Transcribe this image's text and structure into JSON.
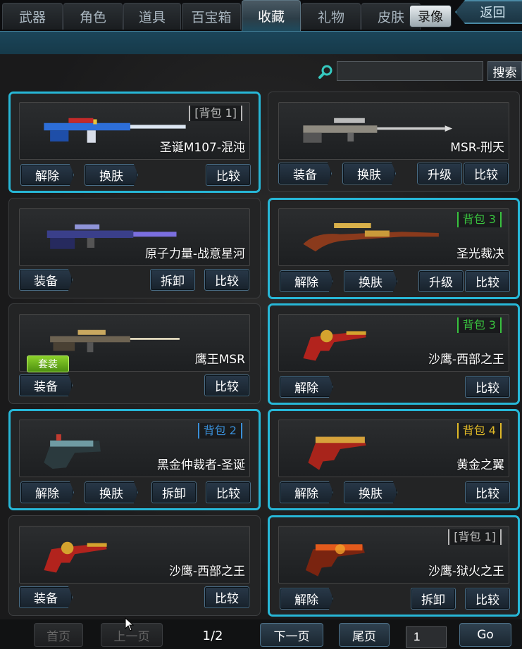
{
  "tabs": [
    {
      "label": "武器",
      "active": false
    },
    {
      "label": "角色",
      "active": false
    },
    {
      "label": "道具",
      "active": false
    },
    {
      "label": "百宝箱",
      "active": false
    },
    {
      "label": "收藏",
      "active": true
    },
    {
      "label": "礼物",
      "active": false
    },
    {
      "label": "皮肤",
      "active": false
    }
  ],
  "header": {
    "video_label": "录像",
    "back_label": "返回"
  },
  "search": {
    "placeholder": "",
    "button_label": "搜索"
  },
  "items": [
    {
      "name": "圣诞M107-混沌",
      "badge": "[背包 1]",
      "badge_color": "#b7b7b7",
      "selected": true,
      "tag": "",
      "buttons": [
        "解除",
        "换肤",
        "比较"
      ],
      "icon": "sniper-rifle-christmas-icon"
    },
    {
      "name": "MSR-刑天",
      "badge": "",
      "badge_color": "",
      "selected": false,
      "tag": "",
      "buttons": [
        "装备",
        "换肤",
        "升级",
        "比较"
      ],
      "icon": "sniper-rifle-silver-icon"
    },
    {
      "name": "原子力量-战意星河",
      "badge": "",
      "badge_color": "",
      "selected": false,
      "tag": "",
      "buttons": [
        "装备",
        "拆卸",
        "比较"
      ],
      "icon": "sniper-rifle-galaxy-icon"
    },
    {
      "name": "圣光裁决",
      "badge": "背包 3",
      "badge_color": "#39c23f",
      "selected": true,
      "tag": "",
      "buttons": [
        "解除",
        "换肤",
        "升级",
        "比较"
      ],
      "icon": "sniper-rifle-gold-icon"
    },
    {
      "name": "鹰王MSR",
      "badge": "",
      "badge_color": "",
      "selected": false,
      "tag": "套装",
      "buttons": [
        "装备",
        "比较"
      ],
      "icon": "sniper-rifle-eagle-icon"
    },
    {
      "name": "沙鹰-西部之王",
      "badge": "背包 3",
      "badge_color": "#39c23f",
      "selected": true,
      "tag": "",
      "buttons": [
        "解除",
        "比较"
      ],
      "icon": "revolver-red-icon"
    },
    {
      "name": "黑金仲裁者-圣诞",
      "badge": "背包 2",
      "badge_color": "#3a8fd8",
      "selected": true,
      "tag": "",
      "buttons": [
        "解除",
        "换肤",
        "拆卸",
        "比较"
      ],
      "icon": "pistol-blackgold-icon"
    },
    {
      "name": "黄金之翼",
      "badge": "背包 4",
      "badge_color": "#e0b928",
      "selected": true,
      "tag": "",
      "buttons": [
        "解除",
        "换肤",
        "比较"
      ],
      "icon": "pistol-golden-wing-icon"
    },
    {
      "name": "沙鹰-西部之王",
      "badge": "",
      "badge_color": "",
      "selected": false,
      "tag": "",
      "buttons": [
        "装备",
        "比较"
      ],
      "icon": "revolver-red-icon"
    },
    {
      "name": "沙鹰-狱火之王",
      "badge": "[背包 1]",
      "badge_color": "#b7b7b7",
      "selected": true,
      "tag": "",
      "buttons": [
        "解除",
        "拆卸",
        "比较"
      ],
      "icon": "pistol-hellfire-icon"
    }
  ],
  "pagination": {
    "first": "首页",
    "prev": "上一页",
    "indicator": "1/2",
    "next": "下一页",
    "last": "尾页",
    "page_input": "1",
    "go": "Go"
  },
  "colors": {
    "selected_border": "#27b7d7",
    "accent": "#1b4559"
  }
}
